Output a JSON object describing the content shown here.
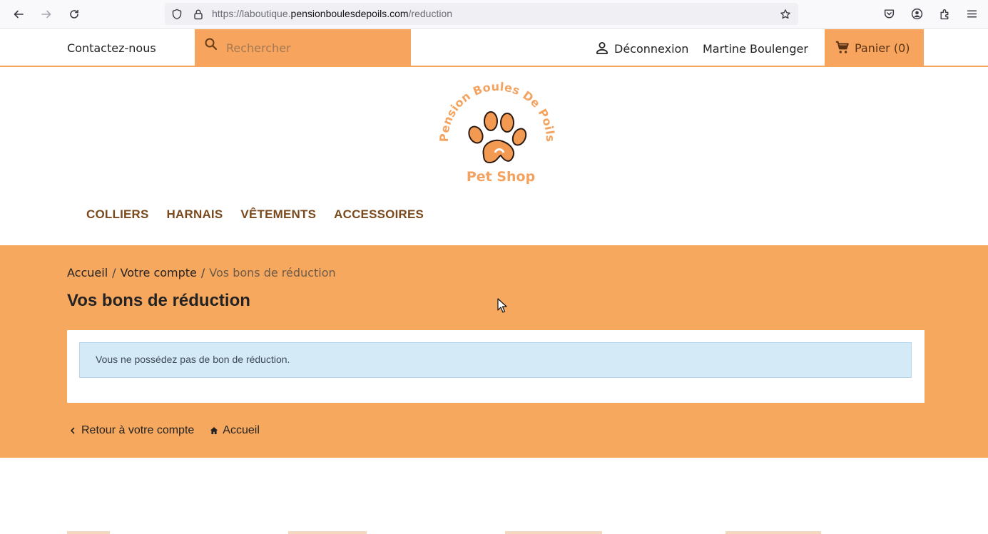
{
  "browser": {
    "url_prefix": "https://laboutique.",
    "url_domain": "pensionboulesdepoils.com",
    "url_path": "/reduction"
  },
  "header": {
    "contact": "Contactez-nous",
    "search_placeholder": "Rechercher",
    "logout": "Déconnexion",
    "username": "Martine Boulenger",
    "cart": "Panier (0)"
  },
  "logo": {
    "arc_text": "Pension Boules De Poils",
    "tagline": "Pet Shop"
  },
  "nav": {
    "items": [
      "COLLIERS",
      "HARNAIS",
      "VÊTEMENTS",
      "ACCESSOIRES"
    ]
  },
  "breadcrumb": {
    "home": "Accueil",
    "account": "Votre compte",
    "current": "Vos bons de réduction"
  },
  "page": {
    "title": "Vos bons de réduction",
    "alert": "Vous ne possédez pas de bon de réduction."
  },
  "footer_links": {
    "back": "Retour à votre compte",
    "home": "Accueil"
  },
  "colors": {
    "accent": "#f7a55e",
    "nav_text": "#7a4a1e",
    "alert_bg": "#d5eaf7"
  }
}
